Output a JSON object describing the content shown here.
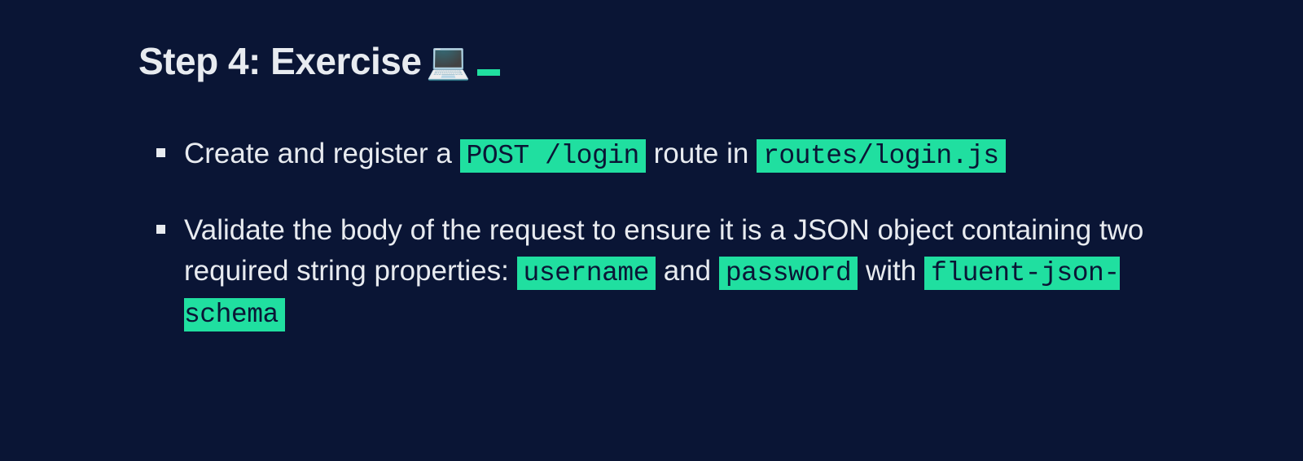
{
  "heading": {
    "text": "Step 4: Exercise",
    "emoji": "💻"
  },
  "items": [
    {
      "parts": [
        {
          "type": "text",
          "value": "Create and register a "
        },
        {
          "type": "code",
          "value": "POST /login"
        },
        {
          "type": "text",
          "value": " route in "
        },
        {
          "type": "code",
          "value": "routes/login.js"
        }
      ]
    },
    {
      "parts": [
        {
          "type": "text",
          "value": "Validate the body of the request to ensure it is a JSON object containing two required string properties: "
        },
        {
          "type": "code",
          "value": "username"
        },
        {
          "type": "text",
          "value": " and "
        },
        {
          "type": "code",
          "value": "password"
        },
        {
          "type": "text",
          "value": " with "
        },
        {
          "type": "code",
          "value": "fluent-json-schema"
        }
      ]
    }
  ]
}
